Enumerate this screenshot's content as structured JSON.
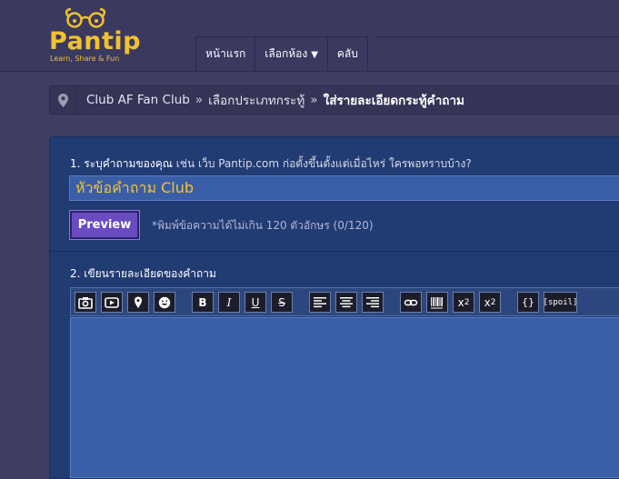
{
  "logo": {
    "name": "Pantip",
    "tagline": "Learn, Share & Fun",
    "color": "#f2c12e"
  },
  "nav": {
    "items": [
      {
        "label": "หน้าแรก"
      },
      {
        "label": "เลือกห้อง",
        "caret": "▼"
      },
      {
        "label": "คลับ"
      }
    ]
  },
  "breadcrumb": {
    "items": [
      "Club AF Fan Club",
      "เลือกประเภทกระทู้"
    ],
    "separator": "»",
    "current": "ใส่รายละเอียดกระทู้คำถาม"
  },
  "form": {
    "question_label": "1. ระบุคำถามของคุณ",
    "question_hint": "เช่น เว็บ Pantip.com ก่อตั้งขึ้นตั้งแต่เมื่อไหร่ ใครพอทราบบ้าง?",
    "title_value": "หัวข้อคำถาม Club",
    "preview_label": "Preview",
    "limit_note": "*พิมพ์ข้อความได้ไม่เกิน 120 ตัวอักษร (0/120)",
    "detail_label": "2. เขียนรายละเอียดของคำถาม",
    "toolbar": {
      "bold": "B",
      "italic": "I",
      "underline": "U",
      "strike": "S",
      "sup": "x",
      "sup_mark": "2",
      "sub": "x",
      "sub_mark": "2",
      "code": "{}",
      "spoil": "[spoil]"
    }
  },
  "colors": {
    "panel": "#213b73",
    "input": "#3a5ea5",
    "accent": "#6a4cc0",
    "title_text": "#f5c332"
  }
}
